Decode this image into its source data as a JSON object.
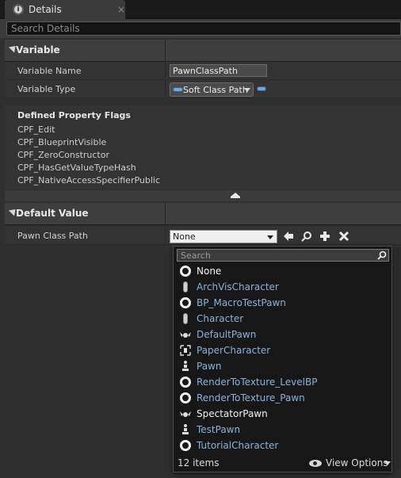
{
  "tab": {
    "title": "Details",
    "close": "×"
  },
  "search": {
    "placeholder": "Search Details"
  },
  "variable": {
    "header": "Variable",
    "name_label": "Variable Name",
    "name_value": "PawnClassPath",
    "type_label": "Variable Type",
    "type_value": "Soft Class Path"
  },
  "flags": {
    "title": "Defined Property Flags",
    "items": [
      "CPF_Edit",
      "CPF_BlueprintVisible",
      "CPF_ZeroConstructor",
      "CPF_HasGetValueTypeHash",
      "CPF_NativeAccessSpecifierPublic"
    ]
  },
  "default_value": {
    "header": "Default Value",
    "label": "Pawn Class Path",
    "selected": "None"
  },
  "picker": {
    "search_placeholder": "Search",
    "items": [
      {
        "name": "None",
        "icon": "ring-icon",
        "color": "white"
      },
      {
        "name": "ArchVisCharacter",
        "icon": "capsule-icon",
        "color": "blue"
      },
      {
        "name": "BP_MacroTestPawn",
        "icon": "ring-icon",
        "color": "blue"
      },
      {
        "name": "Character",
        "icon": "capsule-icon",
        "color": "blue"
      },
      {
        "name": "DefaultPawn",
        "icon": "default-pawn-icon",
        "color": "blue"
      },
      {
        "name": "PaperCharacter",
        "icon": "paper-character-icon",
        "color": "blue"
      },
      {
        "name": "Pawn",
        "icon": "pawn-icon",
        "color": "blue"
      },
      {
        "name": "RenderToTexture_LevelBP",
        "icon": "ring-icon",
        "color": "blue"
      },
      {
        "name": "RenderToTexture_Pawn",
        "icon": "ring-icon",
        "color": "blue"
      },
      {
        "name": "SpectatorPawn",
        "icon": "default-pawn-icon",
        "color": "white"
      },
      {
        "name": "TestPawn",
        "icon": "pawn-icon",
        "color": "blue"
      },
      {
        "name": "TutorialCharacter",
        "icon": "ring-icon",
        "color": "blue"
      }
    ],
    "count_label": "12 items",
    "view_options": "View Options"
  },
  "colors": {
    "accent_blue": "#8ab3d9",
    "panel_bg": "#2f2f2f"
  }
}
